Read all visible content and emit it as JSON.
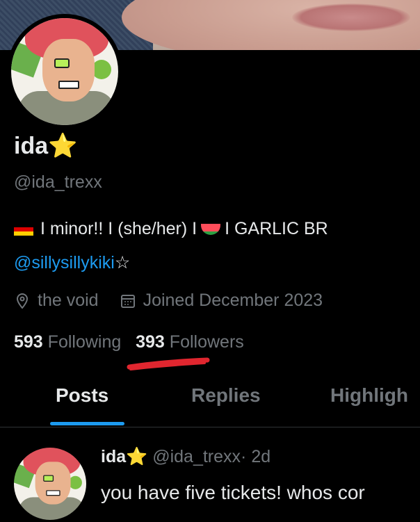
{
  "profile": {
    "name": "ida",
    "name_emoji": "⭐",
    "handle": "@ida_trexx",
    "bio_line1_a": "I minor!! I (she/her) I",
    "bio_line1_b": "I GARLIC BR",
    "bio_mention": "@sillysillykiki",
    "bio_mention_suffix": "☆",
    "location": "the void",
    "joined": "Joined December 2023",
    "following_count": "593",
    "following_label": "Following",
    "followers_count": "393",
    "followers_label": "Followers"
  },
  "tabs": [
    {
      "label": "Posts",
      "active": true
    },
    {
      "label": "Replies",
      "active": false
    },
    {
      "label": "Highligh",
      "active": false
    }
  ],
  "post": {
    "name": "ida",
    "name_emoji": "⭐",
    "handle": "@ida_trexx",
    "time": "· 2d",
    "text": "you have five tickets! whos cor"
  },
  "colors": {
    "background": "#000000",
    "accent": "#1d9bf0",
    "muted": "#71767b",
    "scribble": "#e0262f"
  },
  "icons": [
    "location-pin-icon",
    "calendar-icon"
  ]
}
